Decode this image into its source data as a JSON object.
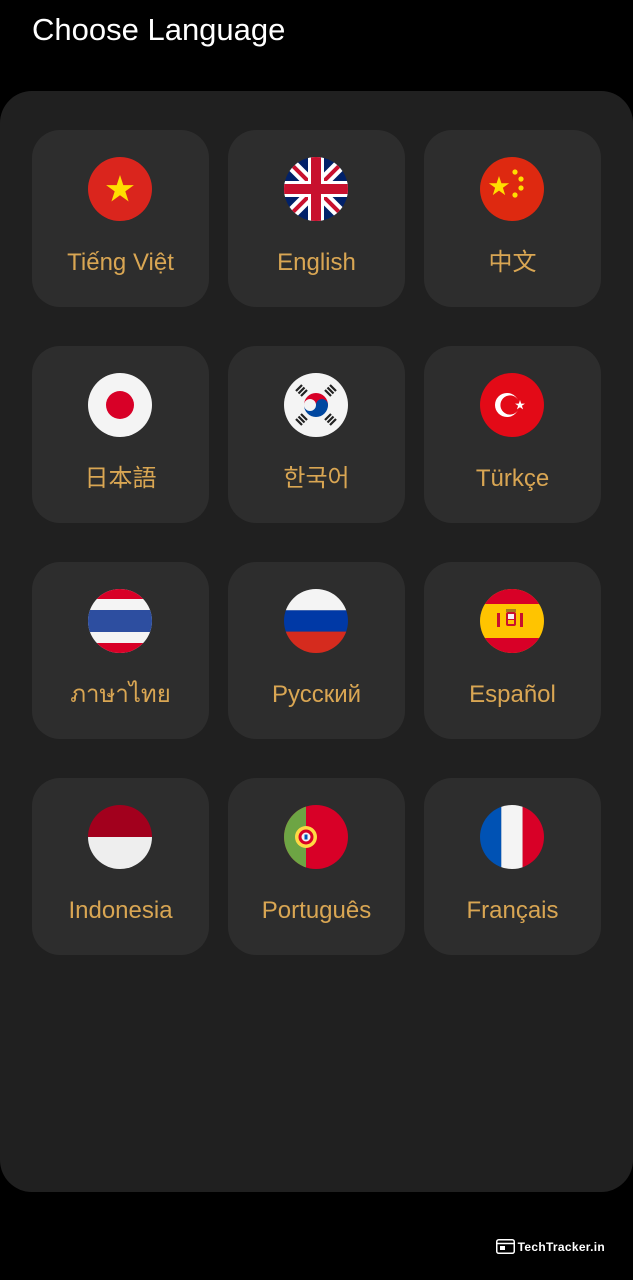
{
  "header": {
    "title": "Choose Language"
  },
  "languages": [
    {
      "label": "Tiếng Việt",
      "flag": "vietnam-flag-icon"
    },
    {
      "label": "English",
      "flag": "uk-flag-icon"
    },
    {
      "label": "中文",
      "flag": "china-flag-icon"
    },
    {
      "label": "日本語",
      "flag": "japan-flag-icon"
    },
    {
      "label": "한국어",
      "flag": "korea-flag-icon"
    },
    {
      "label": "Türkçe",
      "flag": "turkey-flag-icon"
    },
    {
      "label": "ภาษาไทย",
      "flag": "thailand-flag-icon"
    },
    {
      "label": "Русский",
      "flag": "russia-flag-icon"
    },
    {
      "label": "Español",
      "flag": "spain-flag-icon"
    },
    {
      "label": "Indonesia",
      "flag": "indonesia-flag-icon"
    },
    {
      "label": "Português",
      "flag": "portugal-flag-icon"
    },
    {
      "label": "Français",
      "flag": "france-flag-icon"
    }
  ],
  "watermark": {
    "text": "TechTracker.in",
    "icon": "browser-window-icon"
  },
  "colors": {
    "background": "#000000",
    "panel": "#202020",
    "card": "#2d2d2d",
    "label": "#d9a653",
    "title": "#ffffff"
  }
}
